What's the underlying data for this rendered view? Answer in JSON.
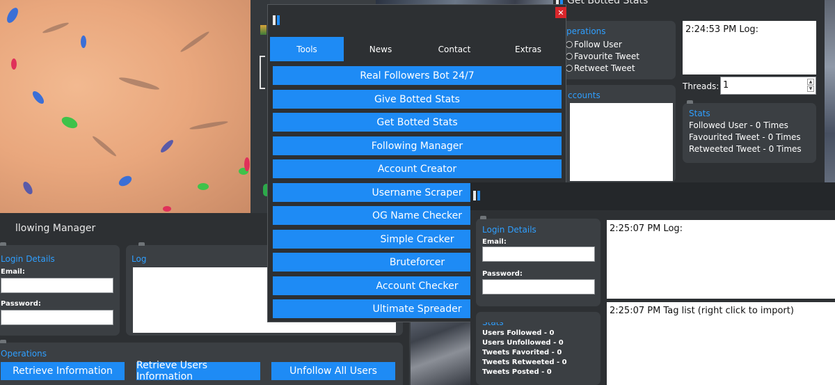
{
  "main_window": {
    "tabs": [
      "Tools",
      "News",
      "Contact",
      "Extras"
    ],
    "tools": [
      "Real Followers Bot 24/7",
      "Give Botted Stats",
      "Get Botted Stats",
      "Following Manager",
      "Account Creator",
      "Username Scraper",
      "OG Name Checker",
      "Simple Cracker",
      "Bruteforcer",
      "Account Checker",
      "Ultimate Spreader"
    ],
    "close_glyph": "✕"
  },
  "botted_stats": {
    "title": "Get Botted Stats",
    "operations_title": "perations",
    "operations": [
      "Follow User",
      "Favourite Tweet",
      "Retweet Tweet"
    ],
    "accounts_title": "ccounts",
    "log": "2:24:53 PM Log:",
    "threads_label": "Threads:",
    "threads_value": "1",
    "stats_title": "Stats",
    "stats": [
      "Followed User - 0 Times",
      "Favourited Tweet - 0 Times",
      "Retweeted Tweet - 0 Times"
    ]
  },
  "following_manager": {
    "title": "llowing Manager",
    "login_title": "Login Details",
    "email_label": "Email:",
    "password_label": "Password:",
    "log_title": "Log",
    "operations_title": "Operations",
    "buttons": [
      "Retrieve Information",
      "Retrieve Users Information",
      "Unfollow All Users"
    ]
  },
  "account_window": {
    "login_title": "Login Details",
    "email_label": "Email:",
    "password_label": "Password:",
    "stats_title": "Stats",
    "stats": [
      "Users Followed - 0",
      "Users Unfollowed - 0",
      "Tweets Favorited - 0",
      "Tweets Retweeted - 0",
      "Tweets Posted - 0"
    ],
    "log": "2:25:07 PM Log:",
    "tag_list": "2:25:07 PM Tag list (right click to import)"
  },
  "colors": {
    "accent": "#1e8bf5",
    "panel_title": "#2f9fff",
    "close": "#d9262b"
  }
}
